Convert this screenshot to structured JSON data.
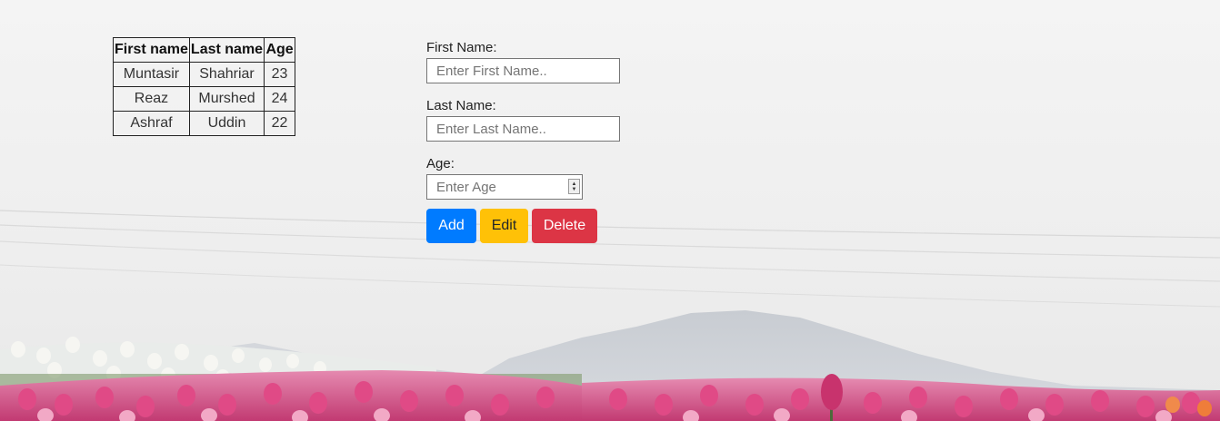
{
  "table": {
    "headers": [
      "First name",
      "Last name",
      "Age"
    ],
    "rows": [
      {
        "first": "Muntasir",
        "last": "Shahriar",
        "age": "23"
      },
      {
        "first": "Reaz",
        "last": "Murshed",
        "age": "24"
      },
      {
        "first": "Ashraf",
        "last": "Uddin",
        "age": "22"
      }
    ]
  },
  "form": {
    "first_name": {
      "label": "First Name:",
      "placeholder": "Enter First Name..",
      "value": ""
    },
    "last_name": {
      "label": "Last Name:",
      "placeholder": "Enter Last Name..",
      "value": ""
    },
    "age": {
      "label": "Age:",
      "placeholder": "Enter Age",
      "value": ""
    }
  },
  "buttons": {
    "add": "Add",
    "edit": "Edit",
    "delete": "Delete"
  },
  "colors": {
    "add": "#007bff",
    "edit": "#ffc107",
    "delete": "#dc3545"
  },
  "background": {
    "icon": "tulip-field-with-mountain-photo"
  }
}
